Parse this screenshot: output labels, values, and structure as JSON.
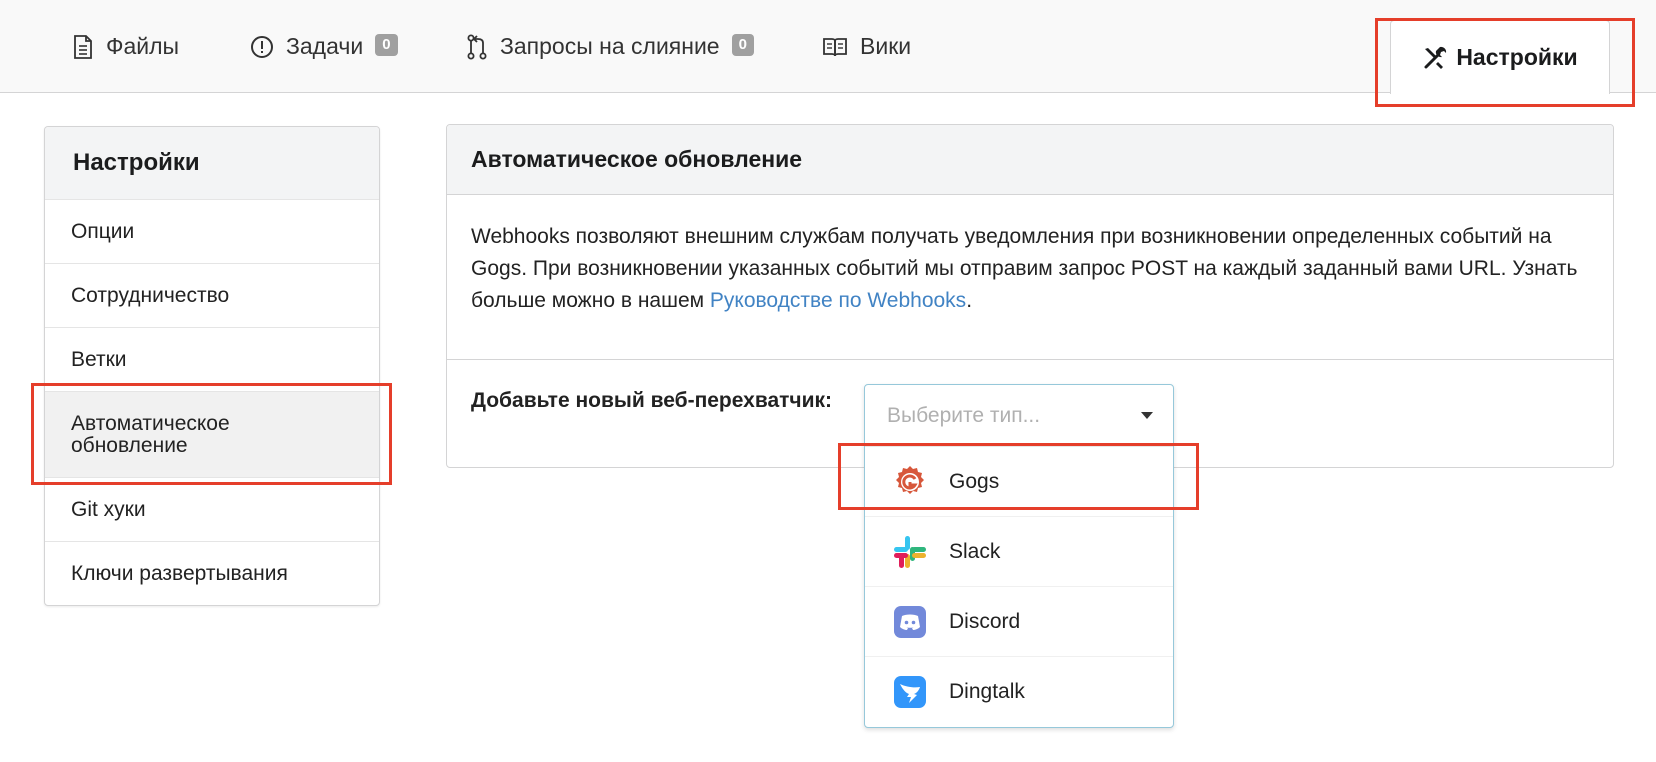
{
  "tabs": [
    {
      "label": "Файлы",
      "icon": "file-text-icon"
    },
    {
      "label": "Задачи",
      "icon": "issue-icon",
      "count": "0"
    },
    {
      "label": "Запросы на слияние",
      "icon": "pull-request-icon",
      "count": "0"
    },
    {
      "label": "Вики",
      "icon": "book-icon"
    }
  ],
  "active_tab": {
    "label": "Настройки",
    "icon": "tools-icon"
  },
  "sidebar": {
    "title": "Настройки",
    "items": [
      {
        "label": "Опции"
      },
      {
        "label": "Сотрудничество"
      },
      {
        "label": "Ветки"
      },
      {
        "label": "Автоматическое обновление",
        "active": true
      },
      {
        "label": "Git хуки"
      },
      {
        "label": "Ключи развертывания"
      }
    ]
  },
  "panel": {
    "title": "Автоматическое обновление",
    "desc_part1": "Webhooks позволяют внешним службам получать уведомления при возникновении определенных событий на Gogs. При возникновении указанных событий мы отправим запрос POST на каждый заданный вами URL. Узнать больше можно в нашем ",
    "desc_link": "Руководстве по Webhooks",
    "desc_end": ".",
    "add_label": "Добавьте новый веб-перехватчик:"
  },
  "dropdown": {
    "placeholder": "Выберите тип...",
    "options": [
      {
        "label": "Gogs",
        "icon": "gogs-logo-icon"
      },
      {
        "label": "Slack",
        "icon": "slack-logo-icon"
      },
      {
        "label": "Discord",
        "icon": "discord-logo-icon"
      },
      {
        "label": "Dingtalk",
        "icon": "dingtalk-logo-icon"
      }
    ]
  },
  "colors": {
    "highlight": "#e53e2a",
    "link": "#4183c4",
    "gogs": "#d7573b",
    "discord": "#7289da",
    "dingtalk": "#3296fa"
  }
}
